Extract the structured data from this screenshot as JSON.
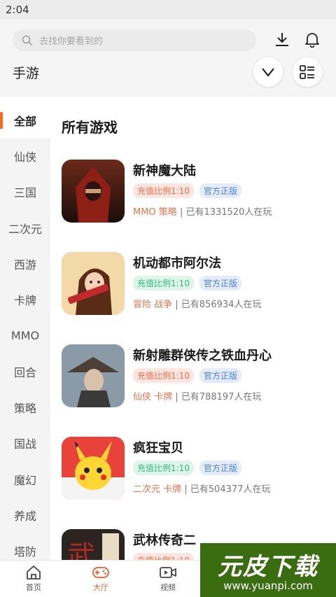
{
  "status_bar": {
    "time": "2:04"
  },
  "header": {
    "search_placeholder": "去找你要看到的",
    "title": "手游"
  },
  "sidebar": {
    "categories": [
      {
        "label": "全部"
      },
      {
        "label": "仙侠"
      },
      {
        "label": "三国"
      },
      {
        "label": "二次元"
      },
      {
        "label": "西游"
      },
      {
        "label": "卡牌"
      },
      {
        "label": "MMO"
      },
      {
        "label": "回合"
      },
      {
        "label": "策略"
      },
      {
        "label": "国战"
      },
      {
        "label": "魔幻"
      },
      {
        "label": "养成"
      },
      {
        "label": "塔防"
      }
    ],
    "active_index": 0
  },
  "main": {
    "section_title": "所有游戏",
    "games": [
      {
        "name": "新神魔大陆",
        "rate": "充值比例1:10",
        "official": "官方正版",
        "genre": "MMO 策略",
        "players": " | 已有1331520人在玩",
        "icon": "hooded-warrior"
      },
      {
        "name": "机动都市阿尔法",
        "rate": "充值比例1:10",
        "official": "官方正版",
        "genre": "冒险 战争",
        "players": " | 已有856934人在玩",
        "icon": "anime-gunner"
      },
      {
        "name": "新射雕群侠传之铁血丹心",
        "rate": "充值比例1:10",
        "official": "官方正版",
        "genre": "仙侠 卡牌",
        "players": " | 已有788197人在玩",
        "icon": "straw-hat-swordsman"
      },
      {
        "name": "疯狂宝贝",
        "rate": "充值比例1:10",
        "official": "官方正版",
        "genre": "二次元 卡牌",
        "players": " | 已有504377人在玩",
        "icon": "yellow-creature"
      },
      {
        "name": "武林传奇二",
        "rate": "充值比例1:10",
        "official": "",
        "genre": "",
        "players": "",
        "icon": "wu-calligraphy"
      }
    ]
  },
  "bottom_nav": {
    "items": [
      {
        "label": "首页",
        "icon": "home-icon"
      },
      {
        "label": "大厅",
        "icon": "gamepad-icon"
      },
      {
        "label": "视频",
        "icon": "video-icon"
      }
    ],
    "active_index": 1
  },
  "watermark": {
    "title": "元皮下载",
    "url": "www.yuanpi.com"
  },
  "colors": {
    "accent": "#f25c2a",
    "official": "#4b7fe0",
    "rate_green": "#2fb981",
    "rate_orange": "#f06f4a"
  }
}
